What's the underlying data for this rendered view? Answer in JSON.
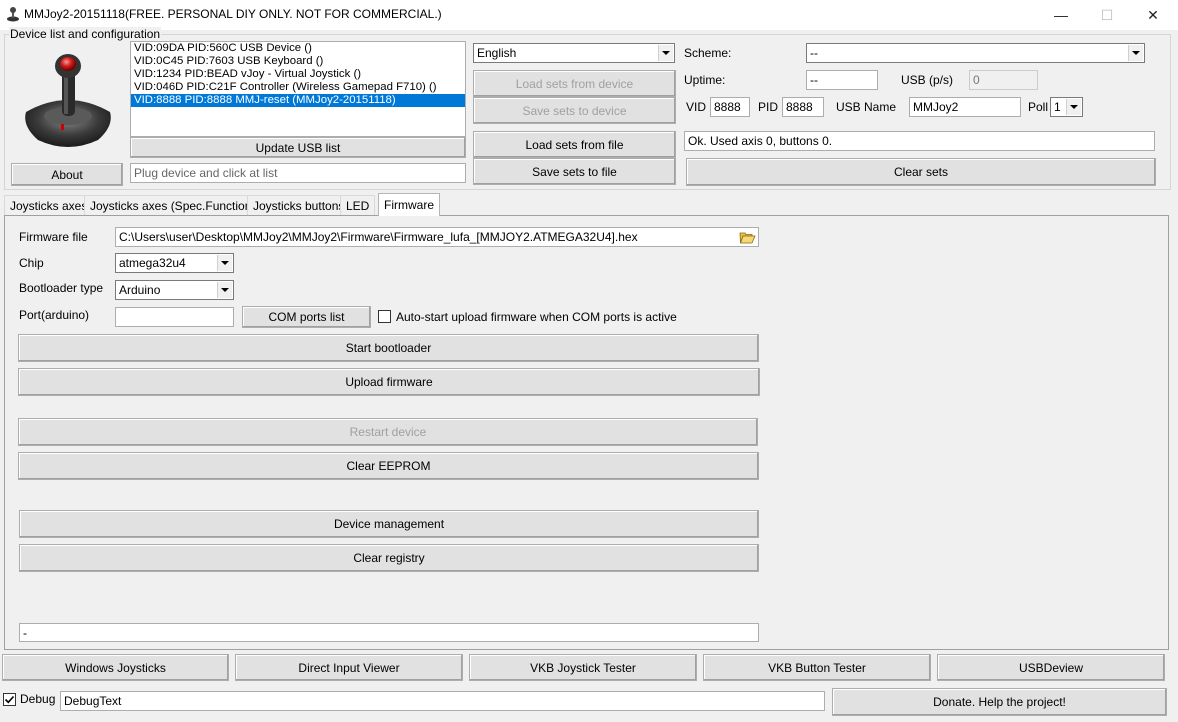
{
  "window": {
    "title": "MMJoy2-20151118(FREE. PERSONAL DIY ONLY. NOT FOR COMMERCIAL.)",
    "minimize": "—",
    "maximize": "☐",
    "close": "✕",
    "icon": "joystick-icon"
  },
  "device_group": {
    "legend": "Device list and configuration",
    "devices": [
      "VID:09DA PID:560C USB Device  ()",
      "VID:0C45 PID:7603 USB Keyboard ()",
      "VID:1234 PID:BEAD vJoy - Virtual Joystick ()",
      "VID:046D PID:C21F Controller (Wireless Gamepad F710) ()",
      "VID:8888 PID:8888 MMJ-reset (MMJoy2-20151118)"
    ],
    "about": "About",
    "update_usb_list": "Update USB list",
    "status_placeholder": "Plug device and click at list",
    "language": "English",
    "load_sets_from_device": "Load sets from device",
    "save_sets_to_device": "Save sets to device",
    "load_sets_from_file": "Load sets from file",
    "save_sets_to_file": "Save sets to file",
    "scheme_label": "Scheme:",
    "scheme_value": "--",
    "uptime_label": "Uptime:",
    "uptime_value": "--",
    "usb_ps_label": "USB (p/s)",
    "usb_ps_value": "0",
    "vid_label": "VID",
    "vid_value": "8888",
    "pid_label": "PID",
    "pid_value": "8888",
    "usb_name_label": "USB Name",
    "usb_name_value": "MMJoy2",
    "poll_label": "Poll",
    "poll_value": "1",
    "info_text": "Ok. Used axis  0, buttons 0.",
    "clear_sets": "Clear sets"
  },
  "tabs": [
    {
      "label": "Joysticks axes",
      "active": false
    },
    {
      "label": "Joysticks axes (Spec.Functions)",
      "active": false
    },
    {
      "label": "Joysticks buttons",
      "active": false
    },
    {
      "label": "LED",
      "active": false
    },
    {
      "label": "Firmware",
      "active": true
    }
  ],
  "firmware": {
    "file_label": "Firmware file",
    "file_value": "C:\\Users\\user\\Desktop\\MMJoy2\\MMJoy2\\Firmware\\Firmware_lufa_[MMJOY2.ATMEGA32U4].hex",
    "chip_label": "Chip",
    "chip_value": "atmega32u4",
    "bootloader_label": "Bootloader type",
    "bootloader_value": "Arduino",
    "port_label": "Port(arduino)",
    "port_value": "",
    "com_ports_list": "COM ports list",
    "autostart_label": "Auto-start upload firmware when COM ports is active",
    "autostart_checked": false,
    "start_bootloader": "Start bootloader",
    "upload_firmware": "Upload firmware",
    "restart_device": "Restart device",
    "clear_eeprom": "Clear EEPROM",
    "device_management": "Device management",
    "clear_registry": "Clear registry",
    "log_value": "-"
  },
  "bottom": {
    "windows_joysticks": "Windows Joysticks",
    "direct_input_viewer": "Direct Input Viewer",
    "vkb_joystick_tester": "VKB Joystick Tester",
    "vkb_button_tester": "VKB Button Tester",
    "usbdeview": "USBDeview",
    "debug_label": "Debug",
    "debug_checked": true,
    "debug_text": "DebugText",
    "donate": "Donate. Help the project!"
  }
}
